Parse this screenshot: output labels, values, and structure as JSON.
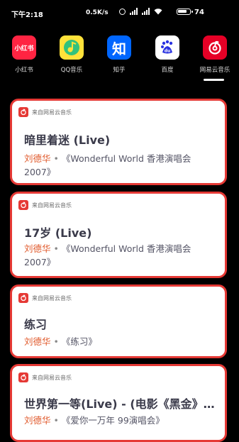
{
  "status_bar": {
    "time": "下午2:18",
    "speed": "0.5K/s",
    "battery": "74"
  },
  "apps": [
    {
      "name": "小红书",
      "icon_text": "小红书",
      "color": "#ff2442"
    },
    {
      "name": "QQ音乐",
      "icon_text": "",
      "color": "#31c27c"
    },
    {
      "name": "知乎",
      "icon_text": "知",
      "color": "#0066ff"
    },
    {
      "name": "百度",
      "icon_text": "du",
      "color": "#ffffff"
    },
    {
      "name": "网易云音乐",
      "icon_text": "",
      "color": "#e60026"
    }
  ],
  "cards": [
    {
      "source": "来自网易云音乐",
      "title": "暗里着迷 (Live)",
      "artist": "刘德华",
      "separator": "•",
      "album_line1": "《Wonderful World 香港演唱会",
      "album_line2": "2007》"
    },
    {
      "source": "来自网易云音乐",
      "title": "17岁 (Live)",
      "artist": "刘德华",
      "separator": "•",
      "album_line1": "《Wonderful World 香港演唱会",
      "album_line2": "2007》"
    },
    {
      "source": "来自网易云音乐",
      "title": "练习",
      "artist": "刘德华",
      "separator": "•",
      "album_line1": "《练习》"
    },
    {
      "source": "来自网易云音乐",
      "title": "世界第一等(Live) - (电影《黑金》…",
      "artist": "刘德华",
      "separator": "•",
      "album_line1": "《爱你一万年 99演唱会》"
    }
  ],
  "colors": {
    "accent": "#e53935",
    "artist": "#e0592b"
  }
}
